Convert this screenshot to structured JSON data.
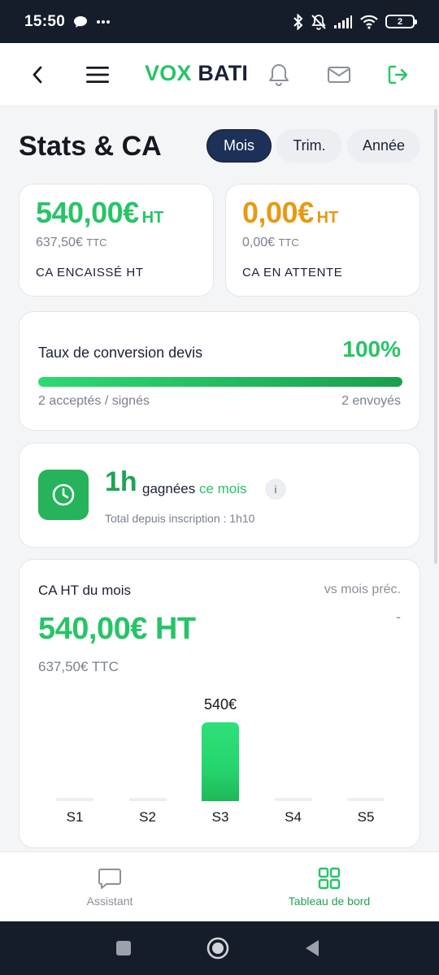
{
  "status_bar": {
    "time": "15:50",
    "battery": "2"
  },
  "header": {
    "logo_part1": "VOX",
    "logo_part2": "BATI"
  },
  "stats": {
    "title": "Stats & CA",
    "periods": [
      "Mois",
      "Trim.",
      "Année"
    ],
    "selected_period": "Mois"
  },
  "kpis": [
    {
      "amount": "540,00€",
      "unit": "HT",
      "ttc_amount": "637,50€",
      "ttc_unit": "TTC",
      "label": "CA ENCAISSÉ HT",
      "color": "#27c466"
    },
    {
      "amount": "0,00€",
      "unit": "HT",
      "ttc_amount": "0,00€",
      "ttc_unit": "TTC",
      "label": "CA EN ATTENTE",
      "color": "#e69a14"
    }
  ],
  "conversion": {
    "title": "Taux de conversion devis",
    "percent_label": "100%",
    "progress": 1.0,
    "accepted": "2 acceptés / signés",
    "sent": "2 envoyés"
  },
  "time_saved": {
    "hours": "1h",
    "text_main": "gagnées",
    "text_period": "ce mois",
    "info": "i",
    "total": "Total depuis inscription : 1h10"
  },
  "ca_month": {
    "title": "CA HT du mois",
    "compare": "vs mois préc.",
    "compare_value": "-",
    "amount": "540,00€ HT",
    "ttc": "637,50€ TTC"
  },
  "chart_data": {
    "type": "bar",
    "categories": [
      "S1",
      "S2",
      "S3",
      "S4",
      "S5"
    ],
    "values": [
      0,
      0,
      540,
      0,
      0
    ],
    "data_labels": [
      "",
      "",
      "540€",
      "",
      ""
    ],
    "title": "",
    "xlabel": "",
    "ylabel": "",
    "bar_color": "#26d46c"
  },
  "bottom_nav": {
    "items": [
      {
        "label": "Assistant",
        "icon": "chat-bubble-icon",
        "active": false
      },
      {
        "label": "Tableau de bord",
        "icon": "grid-icon",
        "active": true
      }
    ]
  },
  "colors": {
    "accent_green": "#27c466",
    "accent_orange": "#e69a14",
    "navy": "#1d3058"
  }
}
